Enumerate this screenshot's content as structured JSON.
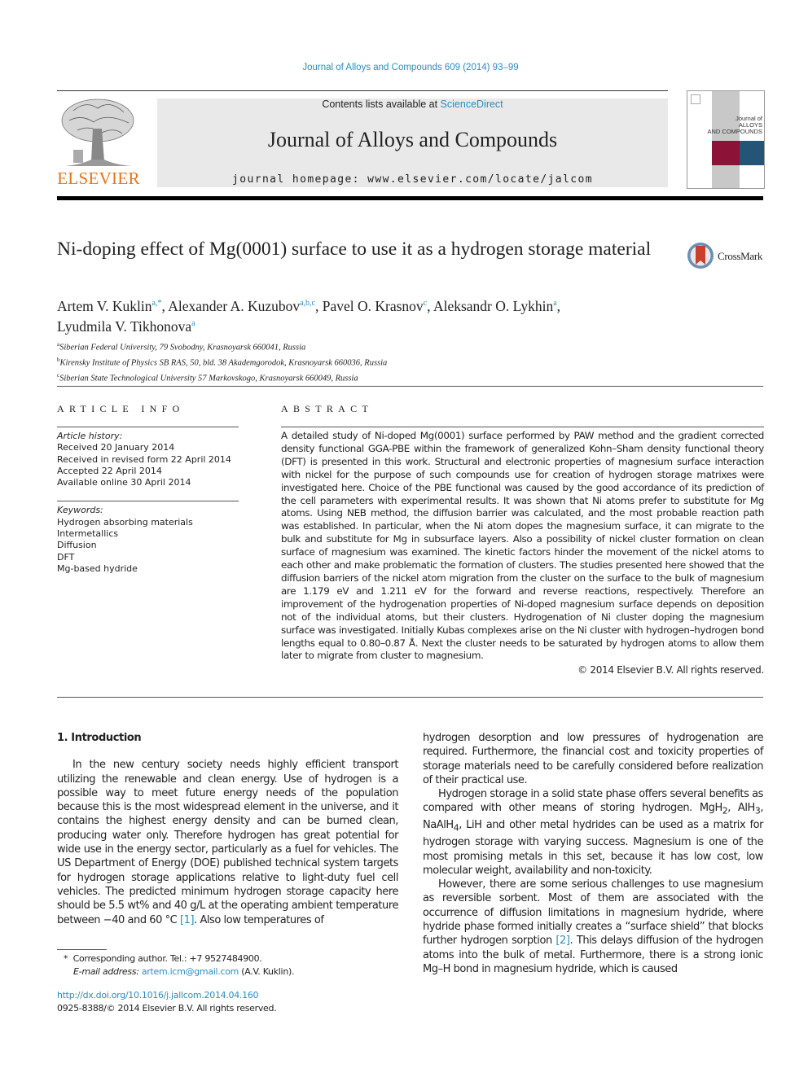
{
  "header": {
    "journal_ref": "Journal of Alloys and Compounds 609 (2014) 93–99",
    "contents_prefix": "Contents lists available at ",
    "contents_link": "ScienceDirect",
    "journal_title": "Journal of Alloys and Compounds",
    "homepage": "journal homepage: www.elsevier.com/locate/jalcom",
    "publisher_logo_text": "ELSEVIER",
    "cover_text": [
      "Journal of",
      "ALLOYS",
      "AND COMPOUNDS"
    ],
    "crossmark_label": "CrossMark"
  },
  "article": {
    "title": "Ni-doping effect of Mg(0001) surface to use it as a hydrogen storage material",
    "authors": [
      {
        "name": "Artem V. Kuklin",
        "sup": "a,*"
      },
      {
        "name": "Alexander A. Kuzubov",
        "sup": "a,b,c"
      },
      {
        "name": "Pavel O. Krasnov",
        "sup": "c"
      },
      {
        "name": "Aleksandr O. Lykhin",
        "sup": "a"
      },
      {
        "name": "Lyudmila V. Tikhonova",
        "sup": "a"
      }
    ],
    "affiliations": [
      {
        "key": "a",
        "text": "Siberian Federal University, 79 Svobodny, Krasnoyarsk 660041, Russia"
      },
      {
        "key": "b",
        "text": "Kirensky Institute of Physics SB RAS, 50, bld. 38 Akademgorodok, Krasnoyarsk 660036, Russia"
      },
      {
        "key": "c",
        "text": "Siberian State Technological University 57 Markovskogo, Krasnoyarsk 660049, Russia"
      }
    ]
  },
  "article_info": {
    "heading": "ARTICLE INFO",
    "history_label": "Article history:",
    "history": [
      "Received 20 January 2014",
      "Received in revised form 22 April 2014",
      "Accepted 22 April 2014",
      "Available online 30 April 2014"
    ],
    "keywords_label": "Keywords:",
    "keywords": [
      "Hydrogen absorbing materials",
      "Intermetallics",
      "Diffusion",
      "DFT",
      "Mg-based hydride"
    ]
  },
  "abstract": {
    "heading": "ABSTRACT",
    "text": "A detailed study of Ni-doped Mg(0001) surface performed by PAW method and the gradient corrected density functional GGA-PBE within the framework of generalized Kohn–Sham density functional theory (DFT) is presented in this work. Structural and electronic properties of magnesium surface interaction with nickel for the purpose of such compounds use for creation of hydrogen storage matrixes were investigated here. Choice of the PBE functional was caused by the good accordance of its prediction of the cell parameters with experimental results. It was shown that Ni atoms prefer to substitute for Mg atoms. Using NEB method, the diffusion barrier was calculated, and the most probable reaction path was established. In particular, when the Ni atom dopes the magnesium surface, it can migrate to the bulk and substitute for Mg in subsurface layers. Also a possibility of nickel cluster formation on clean surface of magnesium was examined. The kinetic factors hinder the movement of the nickel atoms to each other and make problematic the formation of clusters. The studies presented here showed that the diffusion barriers of the nickel atom migration from the cluster on the surface to the bulk of magnesium are 1.179 eV and 1.211 eV for the forward and reverse reactions, respectively. Therefore an improvement of the hydrogenation properties of Ni-doped magnesium surface depends on deposition not of the individual atoms, but their clusters. Hydrogenation of Ni cluster doping the magnesium surface was investigated. Initially Kubas complexes arise on the Ni cluster with hydrogen–hydrogen bond lengths equal to 0.80–0.87 Å. Next the cluster needs to be saturated by hydrogen atoms to allow them later to migrate from cluster to magnesium.",
    "copyright": "© 2014 Elsevier B.V. All rights reserved."
  },
  "intro": {
    "heading": "1. Introduction",
    "left_p1_before": "In the new century society needs highly efficient transport utilizing the renewable and clean energy. Use of hydrogen is a possible way to meet future energy needs of the population because this is the most widespread element in the universe, and it contains the highest energy density and can be burned clean, producing water only. Therefore hydrogen has great potential for wide use in the energy sector, particularly as a fuel for vehicles. The US Department of Energy (DOE) published technical system targets for hydrogen storage applications relative to light-duty fuel cell vehicles. The predicted minimum hydrogen storage capacity here should be 5.5 wt% and 40 g/L at the operating ambient temperature between −40 and 60 °C ",
    "left_p1_ref": "[1]",
    "left_p1_after": ". Also low temperatures of",
    "right_p1": "hydrogen desorption and low pressures of hydrogenation are required. Furthermore, the financial cost and toxicity properties of storage materials need to be carefully considered before realization of their practical use.",
    "right_p2_a": "Hydrogen storage in a solid state phase offers several benefits as compared with other means of storing hydrogen. MgH",
    "right_p2_sub1": "2",
    "right_p2_b": ", AlH",
    "right_p2_sub2": "3",
    "right_p2_c": ", NaAlH",
    "right_p2_sub3": "4",
    "right_p2_d": ", LiH and other metal hydrides can be used as a matrix for hydrogen storage with varying success. Magnesium is one of the most promising metals in this set, because it has low cost, low molecular weight, availability and non-toxicity.",
    "right_p3_before": "However, there are some serious challenges to use magnesium as reversible sorbent. Most of them are associated with the occurrence of diffusion limitations in magnesium hydride, where hydride phase formed initially creates a “surface shield” that blocks further hydrogen sorption ",
    "right_p3_ref": "[2]",
    "right_p3_after": ". This delays diffusion of the hydrogen atoms into the bulk of metal. Furthermore, there is a strong ionic Mg–H bond in magnesium hydride, which is caused"
  },
  "footnotes": {
    "star": "*",
    "corresponding": "Corresponding author. Tel.: +7 9527484900.",
    "email_label": "E-mail address: ",
    "email": "artem.icm@gmail.com",
    "email_suffix": " (A.V. Kuklin).",
    "doi": "http://dx.doi.org/10.1016/j.jallcom.2014.04.160",
    "issn": "0925-8388/© 2014 Elsevier B.V. All rights reserved."
  }
}
